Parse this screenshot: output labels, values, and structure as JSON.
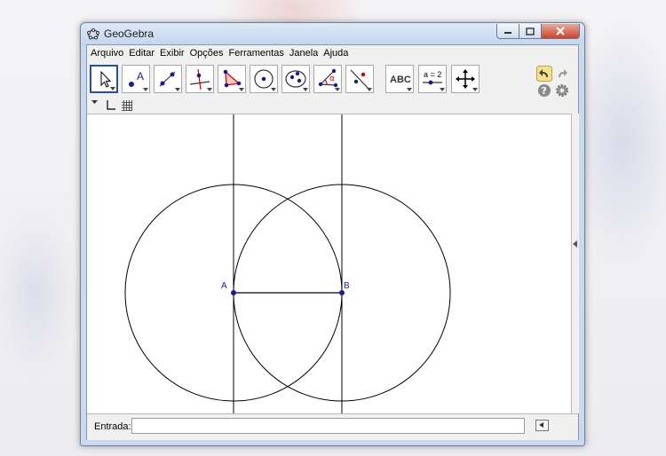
{
  "window": {
    "title": "GeoGebra",
    "icons": {
      "app": "geogebra-icon",
      "minimize": "minimize-icon",
      "maximize": "maximize-icon",
      "close": "close-icon"
    }
  },
  "menubar": {
    "items": [
      "Arquivo",
      "Editar",
      "Exibir",
      "Opções",
      "Ferramentas",
      "Janela",
      "Ajuda"
    ]
  },
  "toolbar": {
    "tools": [
      {
        "icon": "move-arrow-icon"
      },
      {
        "icon": "new-point-icon",
        "label": "A"
      },
      {
        "icon": "line-icon"
      },
      {
        "icon": "perpendicular-line-icon"
      },
      {
        "icon": "polygon-icon"
      },
      {
        "icon": "circle-center-point-icon"
      },
      {
        "icon": "ellipse-icon"
      },
      {
        "icon": "angle-icon",
        "label": "α"
      },
      {
        "icon": "reflect-icon"
      },
      {
        "icon": "text-icon",
        "label": "ABC"
      },
      {
        "icon": "slider-icon",
        "label": "a = 2"
      },
      {
        "icon": "move-graphics-view-icon"
      }
    ],
    "right": {
      "undo": "undo-icon",
      "redo": "redo-icon",
      "help": "help-icon",
      "settings": "gear-icon"
    },
    "active_color": "#2a4f9e"
  },
  "subtoolbar": {
    "icons": [
      "dropdown-triangle-icon",
      "axes-icon",
      "grid-icon"
    ]
  },
  "construction": {
    "points": [
      {
        "label": "A"
      },
      {
        "label": "B"
      }
    ],
    "point_color": "#1b1b8f",
    "label_color": "#1b1b9f",
    "line_color": "#000000"
  },
  "inputbar": {
    "label": "Entrada:",
    "value": "",
    "icon": "virtual-keyboard-icon"
  }
}
